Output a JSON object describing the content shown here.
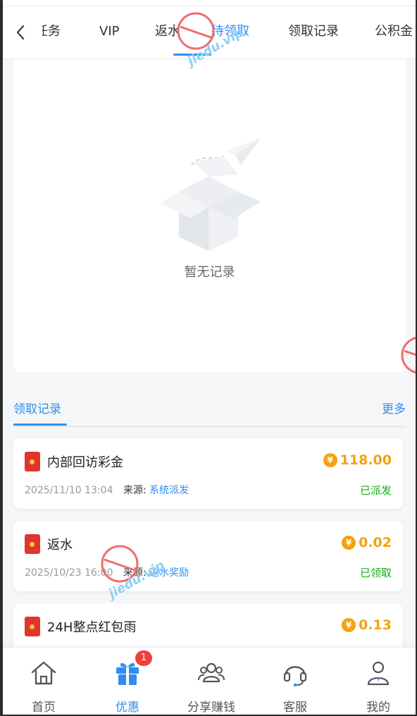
{
  "tabs": [
    {
      "label": "任务",
      "active": false
    },
    {
      "label": "VIP",
      "active": false
    },
    {
      "label": "返水",
      "active": false
    },
    {
      "label": "待领取",
      "active": true
    },
    {
      "label": "领取记录",
      "active": false
    },
    {
      "label": "公积金",
      "active": false
    }
  ],
  "empty_state": {
    "text": "暂无记录"
  },
  "records_section": {
    "title": "领取记录",
    "more": "更多"
  },
  "records": [
    {
      "name": "内部回访彩金",
      "amount": "118.00",
      "date": "2025/11/10 13:04",
      "source_label": "来源:",
      "source": "系统派发",
      "status": "已派发"
    },
    {
      "name": "返水",
      "amount": "0.02",
      "date": "2025/10/23 16:00",
      "source_label": "来源:",
      "source": "返水奖励",
      "status": "已领取"
    },
    {
      "name": "24H整点红包雨",
      "amount": "0.13",
      "date": "",
      "source_label": "",
      "source": "",
      "status": ""
    }
  ],
  "coin_symbol": "¥",
  "nav": [
    {
      "label": "首页",
      "icon": "home-icon"
    },
    {
      "label": "优惠",
      "icon": "gift-icon",
      "badge": "1",
      "active": true
    },
    {
      "label": "分享赚钱",
      "icon": "share-users-icon"
    },
    {
      "label": "客服",
      "icon": "headset-icon"
    },
    {
      "label": "我的",
      "icon": "user-icon"
    }
  ],
  "watermark": "jiedu.vip",
  "colors": {
    "accent": "#2f8ff0",
    "amount": "#f5a20f",
    "status": "#1aad19",
    "envelope": "#e0352b",
    "badge": "#f0403a"
  }
}
